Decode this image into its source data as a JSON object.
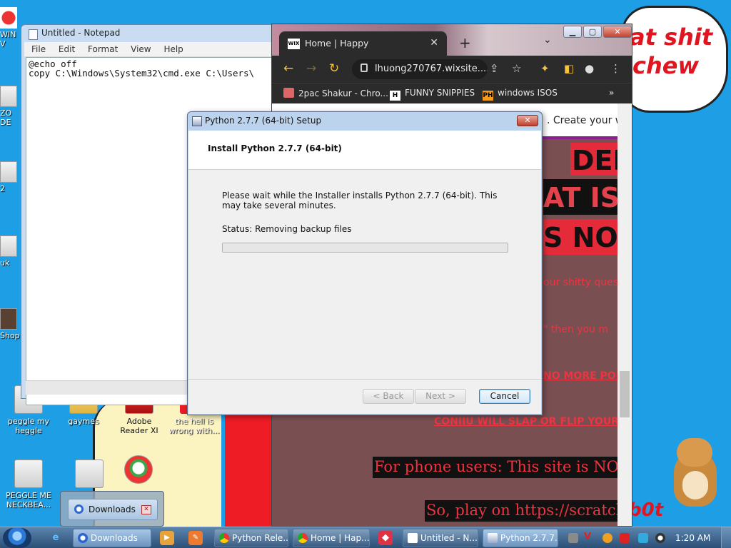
{
  "desktop": {
    "bubble_lines": [
      "at shit",
      "chew"
    ],
    "bot_text": "b0t",
    "icons": [
      {
        "label": "peggle my heggle"
      },
      {
        "label": "gaymes"
      },
      {
        "label": "Adobe Reader XI"
      },
      {
        "label": "the hell is wrong with..."
      },
      {
        "label": "PEGGLE ME NECKBEA..."
      }
    ],
    "edge_labels": [
      "WIN V",
      "ZO DE",
      "2",
      "uk",
      "Shop"
    ]
  },
  "notepad": {
    "title": "Untitled - Notepad",
    "menu": [
      "File",
      "Edit",
      "Format",
      "View",
      "Help"
    ],
    "text": "@echo off\ncopy C:\\Windows\\System32\\cmd.exe C:\\Users\\"
  },
  "chrome": {
    "tab_title": "Home | Happy",
    "tab_favicon": "WIX",
    "url": "lhuong270767.wixsite....",
    "bookmarks": [
      {
        "label": "2pac Shakur - Chro...",
        "icon": "bookmark-folder-icon"
      },
      {
        "label": "FUNNY SNIPPIES",
        "icon": "H"
      },
      {
        "label": "windows ISOS",
        "icon": "PH"
      }
    ],
    "bookmarks_overflow": "»",
    "page": {
      "create_text": ". Create your we",
      "heading1": "DEFE",
      "heading2": "AT IS \"P",
      "heading3": "S NOTHI",
      "line1": "our shitty ques",
      "line2": "\" then you m",
      "link1": "NO MORE PON",
      "link2": "CONIIU WILL SLAP OR FLIP YOUR F",
      "banner1": "For phone users: This site is NOT for p",
      "banner2": "So, play on https://scratch.mit."
    }
  },
  "installer": {
    "title": "Python 2.7.7 (64-bit) Setup",
    "header": "Install Python 2.7.7 (64-bit)",
    "wait_text": "Please wait while the Installer installs Python 2.7.7 (64-bit). This may take several minutes.",
    "status": "Status:  Removing backup files",
    "progress": 0,
    "buttons": {
      "back": "< Back",
      "next": "Next >",
      "cancel": "Cancel"
    }
  },
  "downloads_popup": {
    "label": "Downloads"
  },
  "taskbar": {
    "tasks": [
      {
        "label": "Downloads"
      },
      {
        "label": "Python Rele..."
      },
      {
        "label": "Home | Hap..."
      },
      {
        "label": "Untitled - N..."
      },
      {
        "label": "Python 2.7.7..."
      }
    ],
    "clock": "1:20 AM"
  }
}
